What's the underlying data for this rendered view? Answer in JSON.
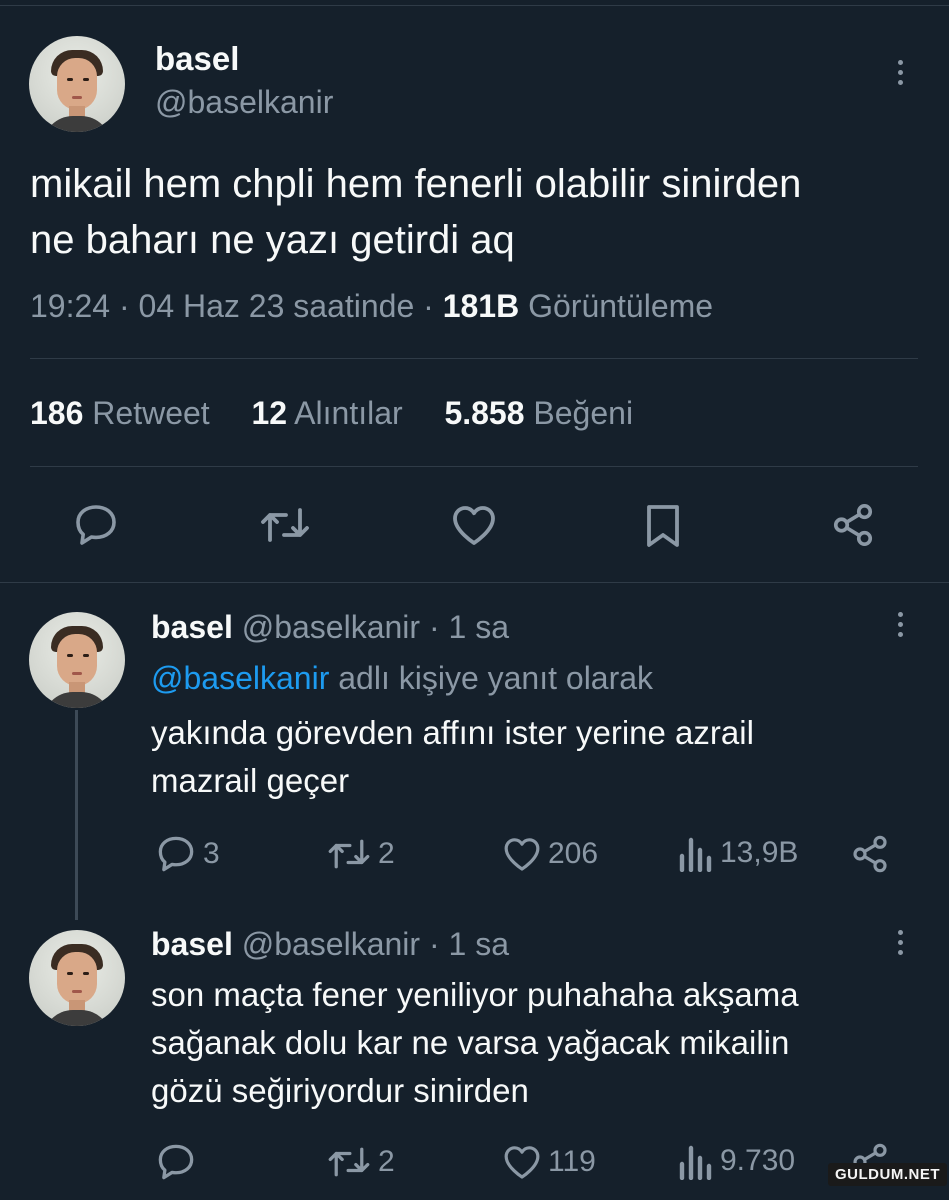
{
  "main_tweet": {
    "author_name": "basel",
    "author_handle": "@baselkanir",
    "text_line1": "mikail hem chpli hem fenerli olabilir sinirden",
    "text_line2": "ne baharı ne yazı getirdi aq",
    "time": "19:24",
    "sep1": "·",
    "date": "04 Haz 23 saatinde",
    "sep2": "·",
    "views_count": "181B",
    "views_label": "Görüntüleme",
    "retweets_count": "186",
    "retweets_label": "Retweet",
    "quotes_count": "12",
    "quotes_label": "Alıntılar",
    "likes_count": "5.858",
    "likes_label": "Beğeni"
  },
  "replies": [
    {
      "author_name": "basel",
      "author_handle": "@baselkanir",
      "time": "· 1 sa",
      "reply_to_handle": "@baselkanir",
      "reply_to_suffix": "adlı kişiye yanıt olarak",
      "text_lines": [
        "yakında görevden affını ister yerine azrail",
        "mazrail geçer"
      ],
      "replies": "3",
      "retweets": "2",
      "likes": "206",
      "views": "13,9B"
    },
    {
      "author_name": "basel",
      "author_handle": "@baselkanir",
      "time": "· 1 sa",
      "text_lines": [
        "son maçta fener yeniliyor puhahaha akşama",
        "sağanak dolu kar ne varsa yağacak mikailin",
        "gözü seğiriyordur sinirden"
      ],
      "replies": "",
      "retweets": "2",
      "likes": "119",
      "views": "9.730"
    }
  ],
  "watermark": "GULDUM.NET",
  "colors": {
    "background": "#15202b",
    "muted": "#8b98a5",
    "accent": "#1d9bf0",
    "divider": "#2f3b47"
  },
  "icons": [
    "reply-icon",
    "retweet-icon",
    "like-icon",
    "bookmark-icon",
    "share-icon",
    "views-icon",
    "more-icon"
  ]
}
